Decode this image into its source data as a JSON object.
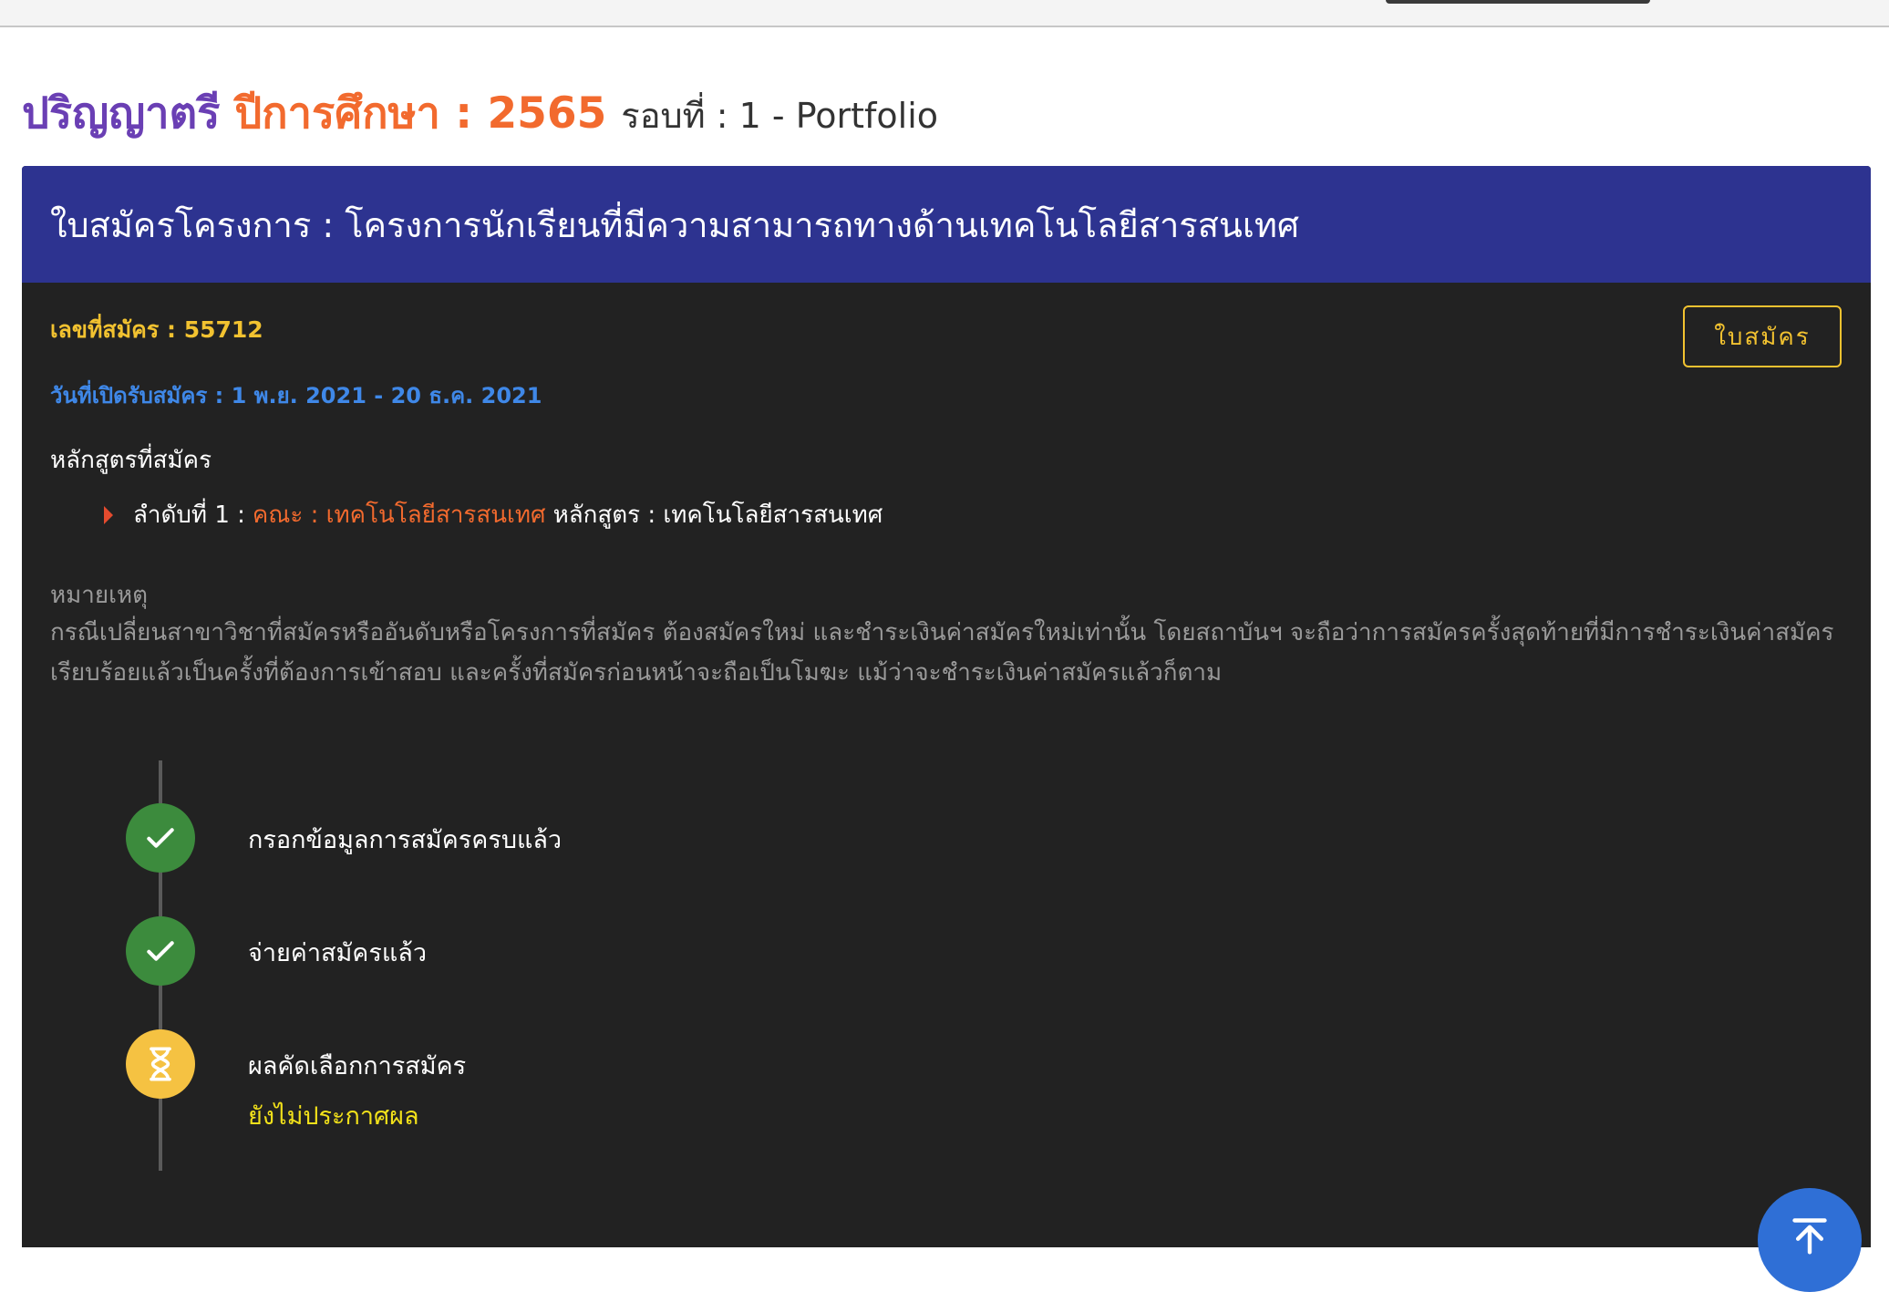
{
  "header": {
    "degree": "ปริญญาตรี",
    "academic_year": "ปีการศึกษา : 2565",
    "round": "รอบที่ : 1 - Portfolio"
  },
  "card": {
    "title": "ใบสมัครโครงการ : โครงการนักเรียนที่มีความสามารถทางด้านเทคโนโลยีสารสนเทศ",
    "application_no": "เลขที่สมัคร : 55712",
    "open_dates": "วันที่เปิดรับสมัคร : 1 พ.ย. 2021 - 20 ธ.ค. 2021",
    "form_button": "ใบสมัคร",
    "courses_title": "หลักสูตรที่สมัคร",
    "course": {
      "order": "ลำดับที่ 1 :",
      "faculty": "คณะ : เทคโนโลยีสารสนเทศ",
      "program": "หลักสูตร : เทคโนโลยีสารสนเทศ"
    },
    "note_title": "หมายเหตุ",
    "note_body": "กรณีเปลี่ยนสาขาวิชาที่สมัครหรืออันดับหรือโครงการที่สมัคร ต้องสมัครใหม่ และชำระเงินค่าสมัครใหม่เท่านั้น โดยสถาบันฯ จะถือว่าการสมัครครั้งสุดท้ายที่มีการชำระเงินค่าสมัครเรียบร้อยแล้วเป็นครั้งที่ต้องการเข้าสอบ และครั้งที่สมัครก่อนหน้าจะถือเป็นโมฆะ แม้ว่าจะชำระเงินค่าสมัครแล้วก็ตาม"
  },
  "timeline": [
    {
      "label": "กรอกข้อมูลการสมัครครบแล้ว",
      "state": "done",
      "icon": "check-icon"
    },
    {
      "label": "จ่ายค่าสมัครแล้ว",
      "state": "done",
      "icon": "check-icon"
    },
    {
      "label": "ผลคัดเลือกการสมัคร",
      "status": "ยังไม่ประกาศผล",
      "state": "pending",
      "icon": "hourglass-icon"
    }
  ],
  "colors": {
    "degree": "#6a3fb4",
    "accent_orange": "#f26a2e",
    "card_header": "#2d3390",
    "card_body": "#222222",
    "yellow": "#f2c230",
    "blue_link": "#3f88e8",
    "success": "#3c8b3d",
    "pending": "#f5c242",
    "fab": "#2f6fd6"
  }
}
